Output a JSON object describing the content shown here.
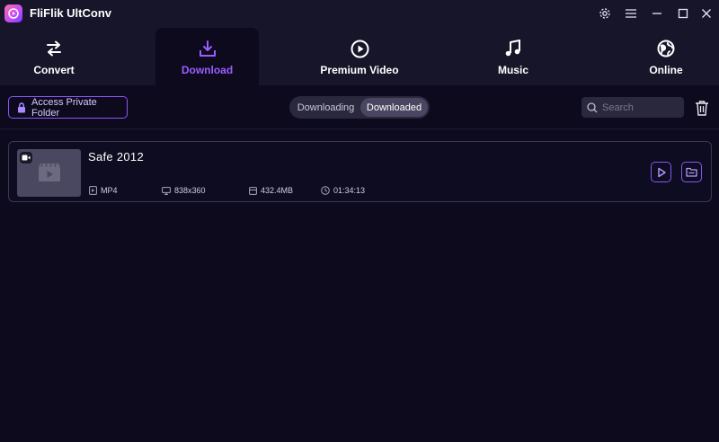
{
  "app": {
    "title": "FliFlik UltConv"
  },
  "window_controls": [
    "gear-icon",
    "menu-icon",
    "minimize-icon",
    "maximize-icon",
    "close-icon"
  ],
  "tabs": [
    {
      "label": "Convert",
      "icon": "convert-arrows-icon",
      "active": false
    },
    {
      "label": "Download",
      "icon": "download-icon",
      "active": true
    },
    {
      "label": "Premium Video",
      "icon": "play-circle-icon",
      "active": false
    },
    {
      "label": "Music",
      "icon": "music-note-icon",
      "active": false
    },
    {
      "label": "Online",
      "icon": "globe-icon",
      "active": false
    }
  ],
  "toolbar": {
    "private_folder_label": "Access Private Folder",
    "segments": [
      {
        "label": "Downloading",
        "active": false
      },
      {
        "label": "Downloaded",
        "active": true
      }
    ],
    "search_placeholder": "Search"
  },
  "items": [
    {
      "title": "Safe  2012",
      "format": "MP4",
      "resolution": "838x360",
      "size": "432.4MB",
      "duration": "01:34:13"
    }
  ],
  "colors": {
    "accent": "#9d5cff",
    "background": "#0c0a1c",
    "bar": "#17152a"
  }
}
